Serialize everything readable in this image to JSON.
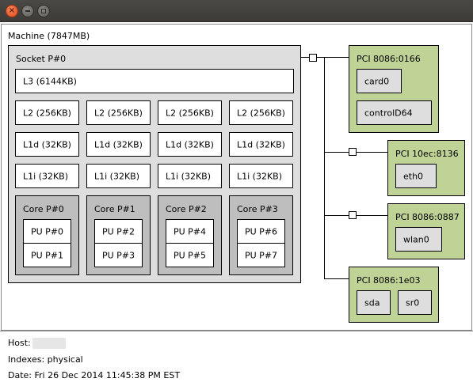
{
  "window": {
    "close_glyph": "×"
  },
  "machine": {
    "label": "Machine (7847MB)"
  },
  "socket": {
    "label": "Socket P#0",
    "l3": "L3 (6144KB)",
    "l2": [
      "L2 (256KB)",
      "L2 (256KB)",
      "L2 (256KB)",
      "L2 (256KB)"
    ],
    "l1d": [
      "L1d (32KB)",
      "L1d (32KB)",
      "L1d (32KB)",
      "L1d (32KB)"
    ],
    "l1i": [
      "L1i (32KB)",
      "L1i (32KB)",
      "L1i (32KB)",
      "L1i (32KB)"
    ],
    "cores": [
      {
        "label": "Core P#0",
        "pus": [
          "PU P#0",
          "PU P#1"
        ]
      },
      {
        "label": "Core P#1",
        "pus": [
          "PU P#2",
          "PU P#3"
        ]
      },
      {
        "label": "Core P#2",
        "pus": [
          "PU P#4",
          "PU P#5"
        ]
      },
      {
        "label": "Core P#3",
        "pus": [
          "PU P#6",
          "PU P#7"
        ]
      }
    ]
  },
  "pci": [
    {
      "label": "PCI 8086:0166",
      "devices": [
        "card0",
        "controlD64"
      ]
    },
    {
      "label": "PCI 10ec:8136",
      "devices": [
        "eth0"
      ]
    },
    {
      "label": "PCI 8086:0887",
      "devices": [
        "wlan0"
      ]
    },
    {
      "label": "PCI 8086:1e03",
      "devices": [
        "sda",
        "sr0"
      ]
    }
  ],
  "footer": {
    "host_label": "Host:",
    "indexes": "Indexes: physical",
    "date": "Date: Fri 26 Dec 2014 11:45:38 PM EST"
  }
}
